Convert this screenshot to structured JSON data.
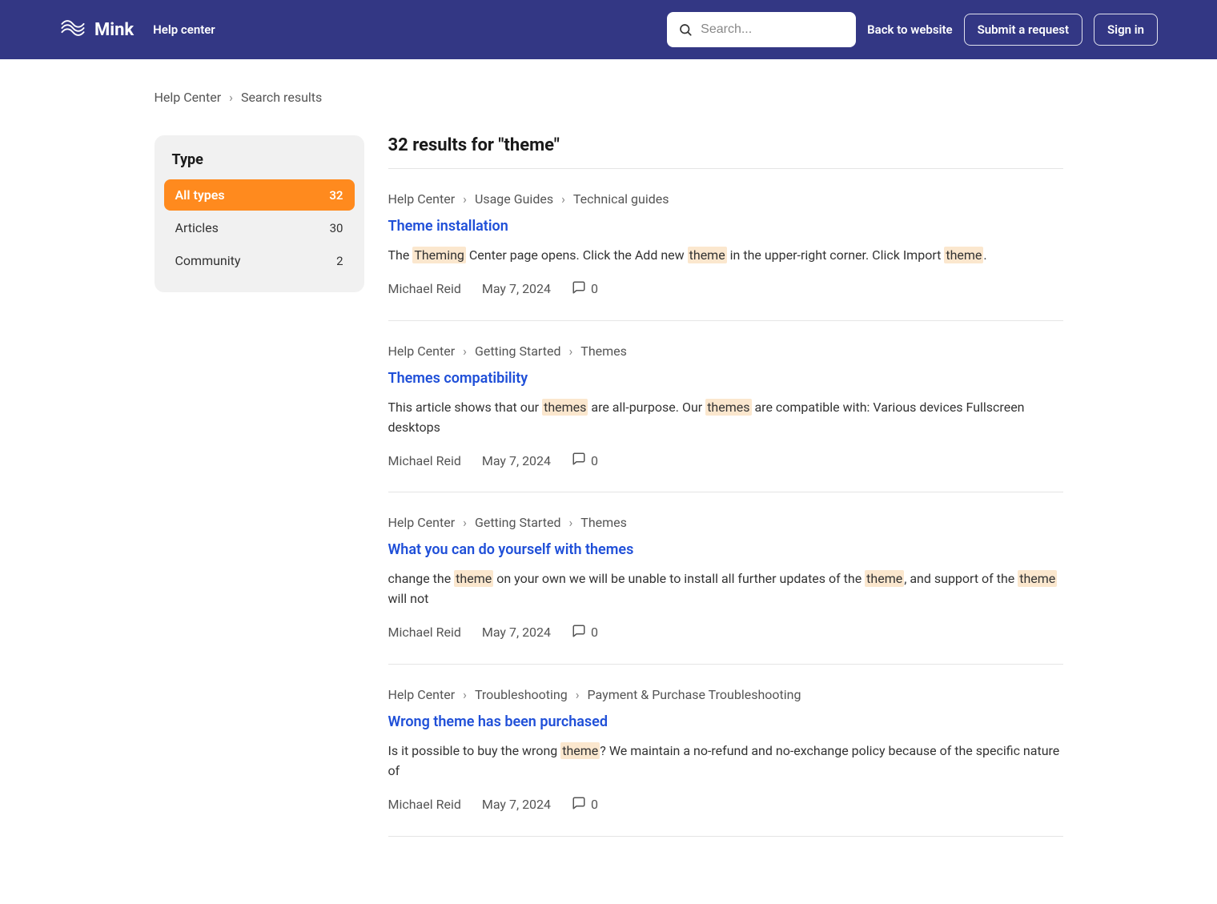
{
  "header": {
    "brand": "Mink",
    "help_center": "Help center",
    "search_placeholder": "Search...",
    "back_link": "Back to website",
    "submit": "Submit a request",
    "sign_in": "Sign in"
  },
  "breadcrumb": {
    "root": "Help Center",
    "current": "Search results"
  },
  "sidebar": {
    "title": "Type",
    "items": [
      {
        "label": "All types",
        "count": "32",
        "active": true
      },
      {
        "label": "Articles",
        "count": "30",
        "active": false
      },
      {
        "label": "Community",
        "count": "2",
        "active": false
      }
    ]
  },
  "results_heading": "32 results for \"theme\"",
  "results": [
    {
      "path": [
        "Help Center",
        "Usage Guides",
        "Technical guides"
      ],
      "title": "Theme installation",
      "body_html": "The <span class=\"hl\">Theming</span> Center page opens. Click the Add new <span class=\"hl\">theme</span> in the upper-right corner. Click Import <span class=\"hl\">theme</span>.",
      "author": "Michael Reid",
      "date": "May 7, 2024",
      "comments": "0"
    },
    {
      "path": [
        "Help Center",
        "Getting Started",
        "Themes"
      ],
      "title": "Themes compatibility",
      "body_html": "This article shows that our <span class=\"hl\">themes</span> are all-purpose. Our <span class=\"hl\">themes</span> are compatible with: Various devices Fullscreen desktops",
      "author": "Michael Reid",
      "date": "May 7, 2024",
      "comments": "0"
    },
    {
      "path": [
        "Help Center",
        "Getting Started",
        "Themes"
      ],
      "title": "What you can do yourself with themes",
      "body_html": "change the <span class=\"hl\">theme</span> on your own we will be unable to install all further updates of the <span class=\"hl\">theme</span>, and support of the <span class=\"hl\">theme</span> will not",
      "author": "Michael Reid",
      "date": "May 7, 2024",
      "comments": "0"
    },
    {
      "path": [
        "Help Center",
        "Troubleshooting",
        "Payment & Purchase Troubleshooting"
      ],
      "title": "Wrong theme has been purchased",
      "body_html": "Is it possible to buy the wrong <span class=\"hl\">theme</span>? We maintain a no-refund and no-exchange policy because of the specific nature of",
      "author": "Michael Reid",
      "date": "May 7, 2024",
      "comments": "0"
    }
  ]
}
